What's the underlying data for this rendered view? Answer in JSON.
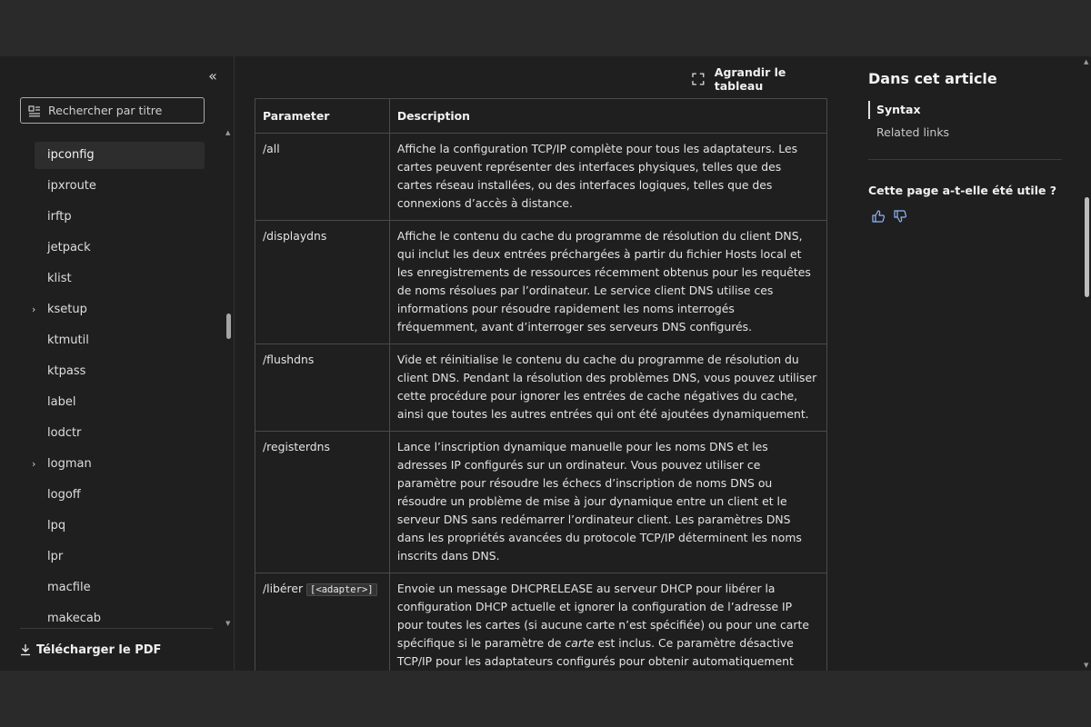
{
  "sidebar": {
    "collapse_glyph": "«",
    "search_placeholder": "Rechercher par titre",
    "items": [
      {
        "label": "ipconfig",
        "active": true,
        "expandable": false
      },
      {
        "label": "ipxroute",
        "active": false,
        "expandable": false
      },
      {
        "label": "irftp",
        "active": false,
        "expandable": false
      },
      {
        "label": "jetpack",
        "active": false,
        "expandable": false
      },
      {
        "label": "klist",
        "active": false,
        "expandable": false
      },
      {
        "label": "ksetup",
        "active": false,
        "expandable": true
      },
      {
        "label": "ktmutil",
        "active": false,
        "expandable": false
      },
      {
        "label": "ktpass",
        "active": false,
        "expandable": false
      },
      {
        "label": "label",
        "active": false,
        "expandable": false
      },
      {
        "label": "lodctr",
        "active": false,
        "expandable": false
      },
      {
        "label": "logman",
        "active": false,
        "expandable": true
      },
      {
        "label": "logoff",
        "active": false,
        "expandable": false
      },
      {
        "label": "lpq",
        "active": false,
        "expandable": false
      },
      {
        "label": "lpr",
        "active": false,
        "expandable": false
      },
      {
        "label": "macfile",
        "active": false,
        "expandable": false
      },
      {
        "label": "makecab",
        "active": false,
        "expandable": false
      }
    ],
    "download_pdf": "Télécharger le PDF"
  },
  "main": {
    "expand_table_label": "Agrandir le tableau",
    "table": {
      "headers": [
        "Parameter",
        "Description"
      ],
      "rows": [
        {
          "param": "/all",
          "desc": "Affiche la configuration TCP/IP complète pour tous les adaptateurs. Les cartes peuvent représenter des interfaces physiques, telles que des cartes réseau installées, ou des interfaces logiques, telles que des connexions d’accès à distance."
        },
        {
          "param": "/displaydns",
          "desc": "Affiche le contenu du cache du programme de résolution du client DNS, qui inclut les deux entrées préchargées à partir du fichier Hosts local et les enregistrements de ressources récemment obtenus pour les requêtes de noms résolues par l’ordinateur. Le service client DNS utilise ces informations pour résoudre rapidement les noms interrogés fréquemment, avant d’interroger ses serveurs DNS configurés."
        },
        {
          "param": "/flushdns",
          "desc": "Vide et réinitialise le contenu du cache du programme de résolution du client DNS. Pendant la résolution des problèmes DNS, vous pouvez utiliser cette procédure pour ignorer les entrées de cache négatives du cache, ainsi que toutes les autres entrées qui ont été ajoutées dynamiquement."
        },
        {
          "param": "/registerdns",
          "desc": "Lance l’inscription dynamique manuelle pour les noms DNS et les adresses IP configurés sur un ordinateur. Vous pouvez utiliser ce paramètre pour résoudre les échecs d’inscription de noms DNS ou résoudre un problème de mise à jour dynamique entre un client et le serveur DNS sans redémarrer l’ordinateur client. Les paramètres DNS dans les propriétés avancées du protocole TCP/IP déterminent les noms inscrits dans DNS."
        },
        {
          "param": "/libérer",
          "param_code": "[<adapter>]",
          "desc_before": "Envoie un message DHCPRELEASE au serveur DHCP pour libérer la configuration DHCP actuelle et ignorer la configuration de l’adresse IP pour toutes les cartes (si aucune carte n’est spécifiée) ou pour une carte spécifique si le paramètre de ",
          "desc_em": "carte",
          "desc_after": " est inclus. Ce paramètre désactive TCP/IP pour les adaptateurs configurés pour obtenir automatiquement une adresse IP. Pour spécifier un nom d’adaptateur, tapez le nom de l’adaptateur qui s’affiche lorsque vous utilisez ipconfig sans paramètres."
        }
      ]
    }
  },
  "aside": {
    "title": "Dans cet article",
    "links": [
      {
        "label": "Syntax",
        "active": true
      },
      {
        "label": "Related links",
        "active": false
      }
    ],
    "feedback_question": "Cette page a-t-elle été utile ?"
  }
}
